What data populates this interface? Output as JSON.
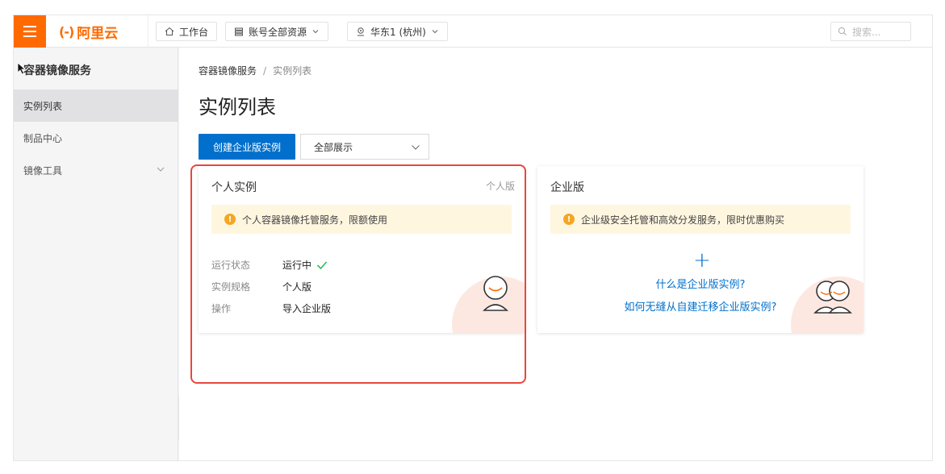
{
  "topbar": {
    "logo_text": "阿里云",
    "logo_mark": "(-)",
    "nav": [
      {
        "label": "工作台",
        "icon": "home-icon"
      },
      {
        "label": "账号全部资源",
        "icon": "list-icon"
      },
      {
        "label": "华东1 (杭州)",
        "icon": "location-icon"
      }
    ],
    "search_placeholder": "搜索..."
  },
  "sidebar": {
    "title": "容器镜像服务",
    "items": [
      {
        "label": "实例列表",
        "active": true
      },
      {
        "label": "制品中心",
        "active": false
      },
      {
        "label": "镜像工具",
        "active": false,
        "expandable": true
      }
    ]
  },
  "main": {
    "breadcrumb": {
      "root": "容器镜像服务",
      "sep": "/",
      "current": "实例列表"
    },
    "title": "实例列表",
    "create_button": "创建企业版实例",
    "filter_select": "全部展示",
    "personal_card": {
      "title": "个人实例",
      "tag": "个人版",
      "notice": "个人容器镜像托管服务，限额使用",
      "rows": [
        {
          "key": "运行状态",
          "value": "运行中",
          "status_icon": "check-icon",
          "status_color": "#2dbb55"
        },
        {
          "key": "实例规格",
          "value": "个人版"
        },
        {
          "key": "操作",
          "value": "导入企业版",
          "is_link": true
        }
      ]
    },
    "enterprise_card": {
      "title": "企业版",
      "notice": "企业级安全托管和高效分发服务，限时优惠购买",
      "add_icon": "+",
      "links": [
        "什么是企业版实例?",
        "如何无缝从自建迁移企业版实例?"
      ]
    }
  },
  "colors": {
    "brand": "#ff6a00",
    "primary": "#0070cc",
    "warning": "#f5a623",
    "highlight": "#e8473c"
  }
}
